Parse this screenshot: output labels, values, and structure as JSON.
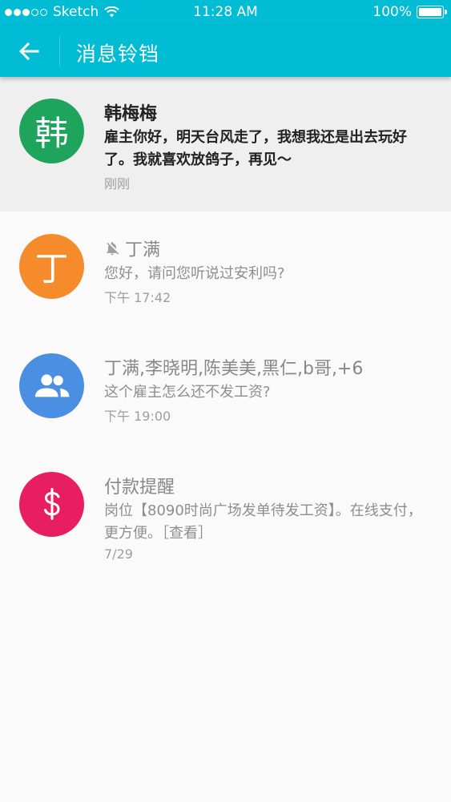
{
  "status_bar": {
    "carrier": "Sketch",
    "time": "11:28 AM",
    "battery": "100%",
    "signal_bars_filled": 3,
    "signal_bars_total": 5
  },
  "app_bar": {
    "title": "消息铃铛",
    "back_icon": "arrow-left-icon"
  },
  "colors": {
    "primary": "#00bcd4",
    "avatar_green": "#1ea45c",
    "avatar_orange": "#f68b2c",
    "avatar_blue": "#4a8fe2",
    "avatar_pink": "#e81e63"
  },
  "messages": [
    {
      "avatar_text": "韩",
      "avatar_color": "#1ea45c",
      "name": "韩梅梅",
      "text": "雇主你好，明天台风走了，我想我还是出去玩好了。我就喜欢放鸽子，再见～",
      "time": "刚刚",
      "unread": true,
      "muted": false
    },
    {
      "avatar_text": "丁",
      "avatar_color": "#f68b2c",
      "name": "丁满",
      "text": "您好，请问您听说过安利吗?",
      "time": "下午 17:42",
      "unread": false,
      "muted": true
    },
    {
      "avatar_icon": "group-icon",
      "avatar_color": "#4a8fe2",
      "name": "丁满,李晓明,陈美美,黑仁,b哥,+6",
      "text": "这个雇主怎么还不发工资?",
      "time": "下午 19:00",
      "unread": false,
      "muted": false
    },
    {
      "avatar_icon": "dollar-icon",
      "avatar_color": "#e81e63",
      "name": "付款提醒",
      "text": "岗位【8090时尚广场发单待发工资】。在线支付，更方便。［查看］",
      "time": "7/29",
      "unread": false,
      "muted": false
    }
  ]
}
